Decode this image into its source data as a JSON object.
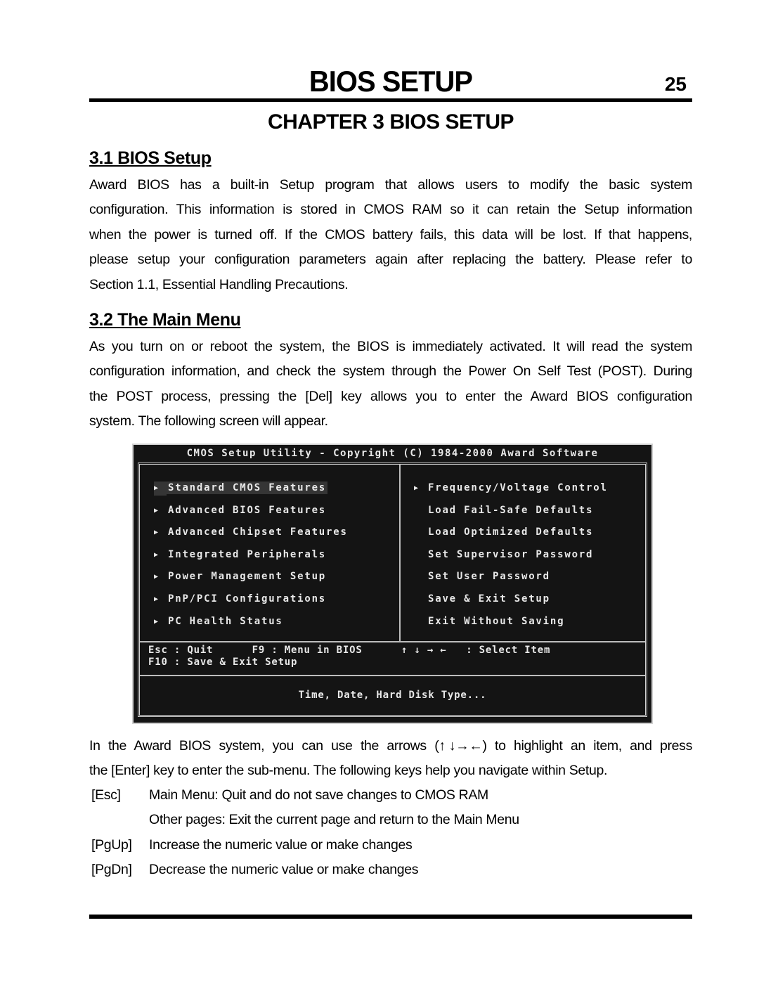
{
  "header": {
    "title": "BIOS SETUP",
    "page_number": "25"
  },
  "chapter_title": "CHAPTER  3  BIOS SETUP",
  "section_1": {
    "heading": "3.1 BIOS Setup",
    "lines": [
      "Award BIOS has a built-in Setup program that allows users to modify the basic system",
      "configuration.  This information is stored in CMOS RAM  so it can retain the Setup information",
      "when the power is turned off.  If the CMOS battery fails, this data will be lost.  If that happens,",
      "please setup your configuration parameters again after replacing the battery.  Please refer to",
      "Section 1.1, Essential Handling Precautions."
    ]
  },
  "section_2": {
    "heading": "3.2 The Main Menu",
    "lines": [
      "As you turn on or reboot the system, the BIOS is immediately activated.  It will read the system",
      "configuration information, and check the system through the Power On Self Test (POST).  During",
      "the POST process, pressing the [Del] key allows you to enter the Award BIOS configuration",
      "system.  The following screen will appear."
    ]
  },
  "bios_screen": {
    "title": "CMOS Setup Utility - Copyright (C) 1984-2000 Award Software",
    "left_menu": [
      {
        "label": "Standard CMOS Features",
        "submenu": true,
        "selected": true
      },
      {
        "label": "Advanced BIOS Features",
        "submenu": true,
        "selected": false
      },
      {
        "label": "Advanced Chipset Features",
        "submenu": true,
        "selected": false
      },
      {
        "label": "Integrated Peripherals",
        "submenu": true,
        "selected": false
      },
      {
        "label": "Power Management Setup",
        "submenu": true,
        "selected": false
      },
      {
        "label": "PnP/PCI Configurations",
        "submenu": true,
        "selected": false
      },
      {
        "label": "PC Health Status",
        "submenu": true,
        "selected": false
      }
    ],
    "right_menu": [
      {
        "label": "Frequency/Voltage Control",
        "submenu": true
      },
      {
        "label": "Load Fail-Safe Defaults",
        "submenu": false
      },
      {
        "label": "Load Optimized Defaults",
        "submenu": false
      },
      {
        "label": "Set Supervisor Password",
        "submenu": false
      },
      {
        "label": "Set User Password",
        "submenu": false
      },
      {
        "label": "Save & Exit Setup",
        "submenu": false
      },
      {
        "label": "Exit Without Saving",
        "submenu": false
      }
    ],
    "key_hints": {
      "row1": "Esc : Quit      F9 : Menu in BIOS      ↑ ↓ → ←   : Select Item",
      "row2": "F10 : Save & Exit Setup"
    },
    "help_text": "Time, Date, Hard Disk Type...",
    "submenu_arrow": "▶"
  },
  "navigation": {
    "line1_before": "In the Award BIOS system, you can use the arrows (",
    "arrows": "↑ ↓→←",
    "line1_after": ") to highlight an item, and press",
    "line2": "the [Enter] key to enter the sub-menu.  The following keys help you navigate within Setup.",
    "keys": [
      {
        "key": "[Esc]",
        "desc": "Main Menu:  Quit and do not save changes to CMOS RAM"
      },
      {
        "key": "",
        "desc": "Other pages:  Exit the current page and return to the Main Menu"
      },
      {
        "key": "[PgUp]",
        "desc": "Increase the numeric value or make changes"
      },
      {
        "key": "[PgDn]",
        "desc": "Decrease the numeric value or make changes"
      }
    ]
  }
}
